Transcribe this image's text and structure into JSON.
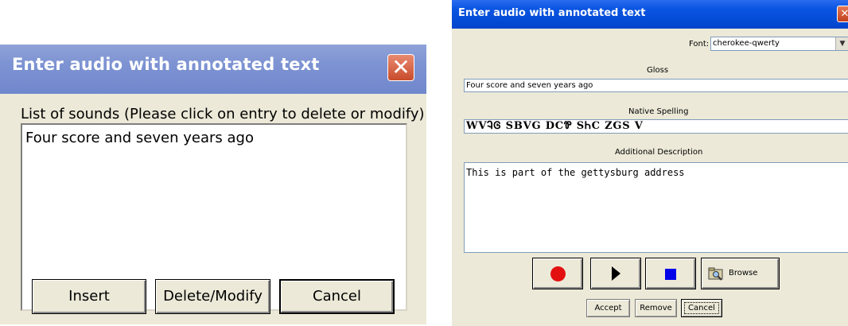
{
  "left_dialog": {
    "title": "Enter audio with annotated text",
    "close_glyph": "✕",
    "list_label": "List of sounds (Please click on entry to delete or modify)",
    "list_items": [
      "Four score and seven years ago"
    ],
    "buttons": {
      "insert": "Insert",
      "delete_modify": "Delete/Modify",
      "cancel": "Cancel"
    }
  },
  "right_dialog": {
    "title": "Enter audio with annotated text",
    "close_glyph": "✕",
    "font_label": "Font:",
    "font_value": "cherokee-qwerty",
    "gloss_label": "Gloss",
    "gloss_value": "Four score and seven years ago",
    "native_label": "Native Spelling",
    "native_value": "WVᎸᎶ SBVG DCᏈ SᏂC ZGS V",
    "description_label": "Additional Description",
    "description_value": "This is part of the gettysburg address",
    "media_buttons": {
      "record_icon": "record-icon",
      "play_icon": "play-icon",
      "stop_icon": "stop-icon",
      "browse_label": "Browse"
    },
    "buttons": {
      "accept": "Accept",
      "remove": "Remove",
      "cancel": "Cancel"
    },
    "colors": {
      "titlebar": "#0a55e2",
      "record": "#e31010",
      "stop": "#0000e8"
    }
  }
}
